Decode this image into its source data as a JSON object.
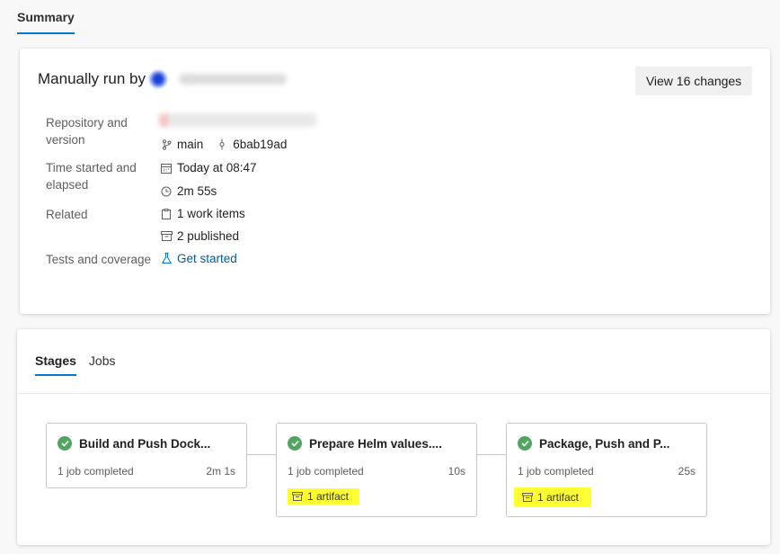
{
  "header": {
    "tab_label": "Summary"
  },
  "summary": {
    "run_label": "Manually run by",
    "view_changes_label": "View 16 changes",
    "labels": {
      "repository": "Repository and version",
      "time": "Time started and elapsed",
      "related": "Related",
      "tests": "Tests and coverage"
    },
    "branch": "main",
    "commit": "6bab19ad",
    "started": "Today at 08:47",
    "elapsed": "2m 55s",
    "work_items": "1 work items",
    "published": "2 published",
    "tests_link": "Get started"
  },
  "stages_panel": {
    "tabs": [
      {
        "label": "Stages"
      },
      {
        "label": "Jobs"
      }
    ],
    "stages": [
      {
        "name": "Build and Push Dock...",
        "jobs": "1 job completed",
        "duration": "2m 1s",
        "artifact": ""
      },
      {
        "name": "Prepare Helm values....",
        "jobs": "1 job completed",
        "duration": "10s",
        "artifact": "1 artifact"
      },
      {
        "name": "Package, Push and P...",
        "jobs": "1 job completed",
        "duration": "25s",
        "artifact": "1 artifact"
      }
    ]
  },
  "colors": {
    "accent": "#0078d4",
    "success": "#55a362",
    "highlight": "#ffff33",
    "link": "#005a9e"
  },
  "icons": {
    "branch": "branch-icon",
    "commit": "commit-icon",
    "calendar": "calendar-icon",
    "clock": "clock-icon",
    "work_item": "clipboard-icon",
    "published": "artifact-icon",
    "tests": "flask-icon",
    "status": "check-circle-icon"
  }
}
